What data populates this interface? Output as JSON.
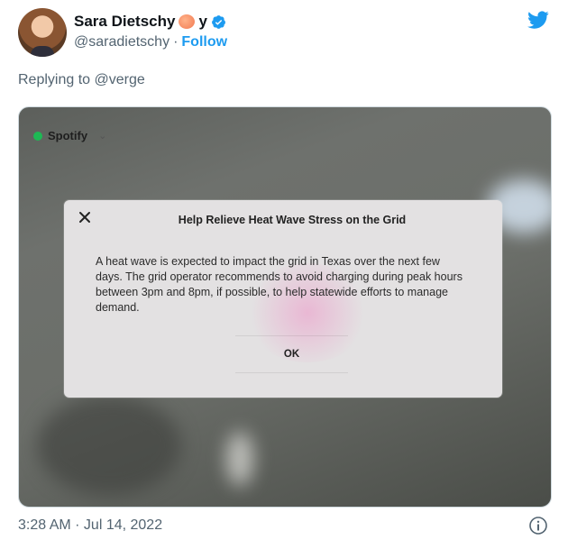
{
  "tweet": {
    "author_name": "Sara Dietschy",
    "name_suffix": "y",
    "handle": "@saradietschy",
    "separator": "·",
    "follow_label": "Follow",
    "replying_to": "Replying to @verge",
    "timestamp": "3:28 AM · Jul 14, 2022"
  },
  "photo": {
    "app_label": "Spotify",
    "dialog": {
      "title": "Help Relieve Heat Wave Stress on the Grid",
      "body": "A heat wave is expected to impact the grid in Texas over the next few days. The grid operator recommends to avoid charging during peak hours between 3pm and 8pm, if possible, to help statewide efforts to manage demand.",
      "ok_label": "OK"
    }
  },
  "colors": {
    "accent": "#1d9bf0",
    "secondary_text": "#536471",
    "spotify_green": "#1db954"
  },
  "icons": [
    "verified-badge-icon",
    "twitter-bird-icon",
    "close-icon",
    "chevron-down-icon",
    "info-icon"
  ]
}
